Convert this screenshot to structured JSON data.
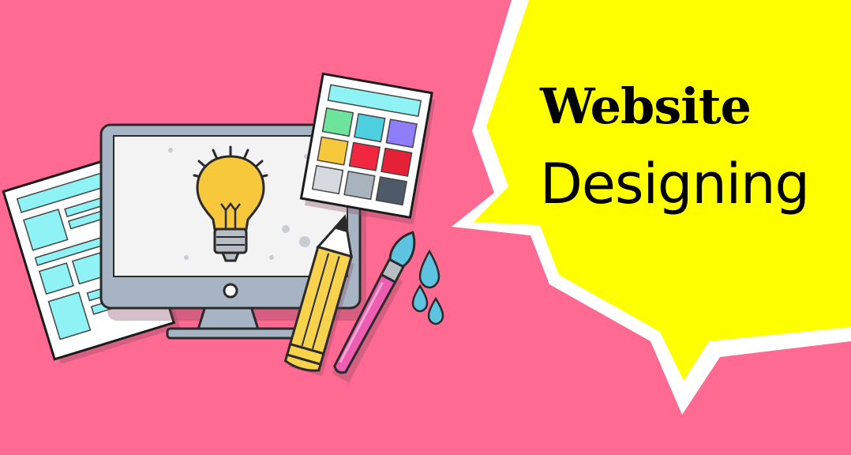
{
  "headline": {
    "line1": "Website",
    "line2": "Designing"
  },
  "colors": {
    "background": "#FF6A93",
    "speech_bubble": "#FFFF00",
    "speech_bubble_outline": "#FFFFFF",
    "wireframe_accent": "#8FF2F5",
    "monitor_frame": "#A7B4C4",
    "lightbulb": "#F7C83B",
    "pencil": "#F7D24C",
    "brush_handle": "#EE5DB0",
    "water_drops": "#5EC3E1"
  },
  "palette_swatches": [
    "#6EE39B",
    "#4ED0E0",
    "#8E7CF8",
    "#F7C83B",
    "#F1273F",
    "#E52138",
    "#D4DAE0",
    "#A9B3BD",
    "#4F5A68"
  ],
  "illustration": {
    "icons": [
      "lightbulb-icon",
      "monitor-icon",
      "wireframe-page-icon",
      "color-palette-icon",
      "pencil-icon",
      "paintbrush-icon",
      "water-drops-icon"
    ]
  }
}
